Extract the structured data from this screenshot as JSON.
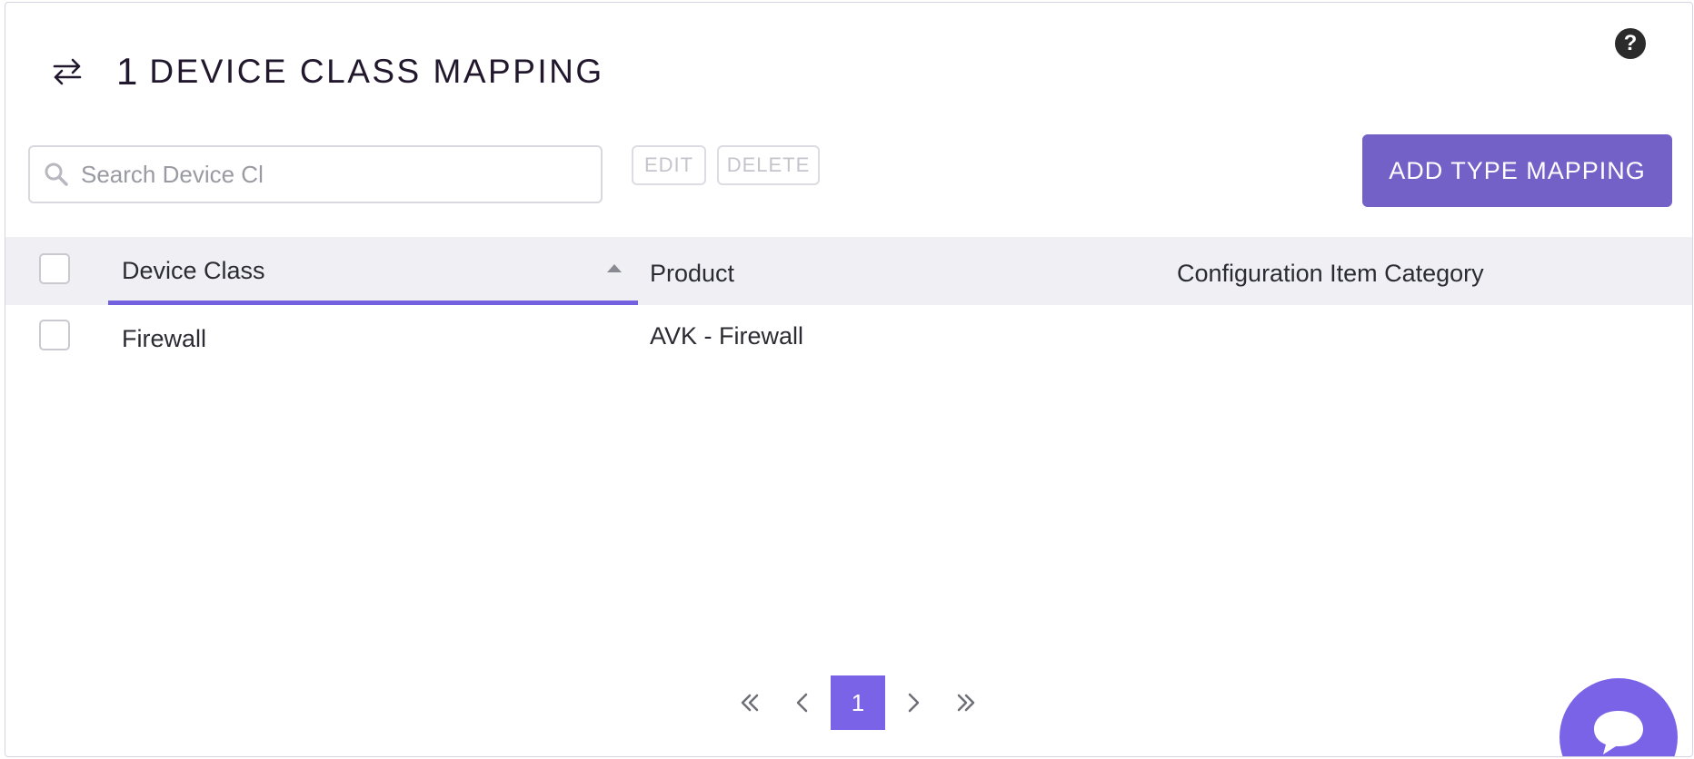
{
  "header": {
    "count": "1",
    "title": "DEVICE CLASS MAPPING"
  },
  "toolbar": {
    "search_placeholder": "Search Device Cl",
    "edit_label": "EDIT",
    "delete_label": "DELETE",
    "add_label": "ADD TYPE MAPPING"
  },
  "table": {
    "columns": [
      "Device Class",
      "Product",
      "Configuration Item Category"
    ],
    "sort_column": "Device Class",
    "sort_direction": "ascending",
    "rows": [
      {
        "device_class": "Firewall",
        "product": "AVK - Firewall",
        "ci_category": ""
      }
    ]
  },
  "pagination": {
    "current_page": "1"
  },
  "icons": {
    "title": "swap-arrows-icon",
    "help": "help-icon",
    "search": "search-icon",
    "first": "double-chevron-left-icon",
    "prev": "chevron-left-icon",
    "next": "chevron-right-icon",
    "last": "double-chevron-right-icon",
    "chat": "chat-icon"
  },
  "colors": {
    "accent": "#7461c7",
    "page_active": "#7b63e8",
    "header_bg": "#efeff4"
  }
}
